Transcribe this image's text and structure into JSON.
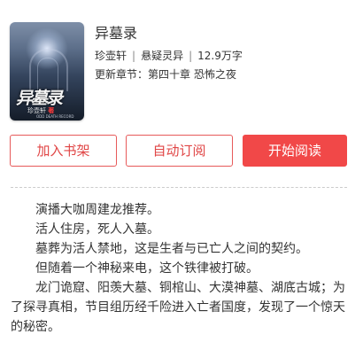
{
  "book": {
    "title": "异墓录",
    "author": "珍壶轩",
    "category": "悬疑灵异",
    "word_count": "12.9万字",
    "latest_label": "更新章节：",
    "latest_chapter": "第四十章",
    "latest_chapter_title": "恐怖之夜",
    "cover": {
      "title": "异墓录",
      "subtitle_prefix": "珍壶轩",
      "subtitle_highlight": "著",
      "english_line": "ODD DEATH RECORD"
    }
  },
  "actions": {
    "add_to_shelf": "加入书架",
    "auto_subscribe": "自动订阅",
    "start_reading": "开始阅读"
  },
  "description": [
    "演播大咖周建龙推荐。",
    "活人住房，死人入墓。",
    "墓葬为活人禁地，这是生者与已亡人之间的契约。",
    "但随着一个神秘来电，这个铁律被打破。",
    "龙门诡窟、阳羡大墓、铜棺山、大漠神墓、湖底古城；为了探寻真相，节目组历经千险进入亡者国度，发现了一个惊天的秘密。"
  ],
  "colors": {
    "accent": "#f14848",
    "text": "#333333",
    "divider": "#cccccc"
  }
}
